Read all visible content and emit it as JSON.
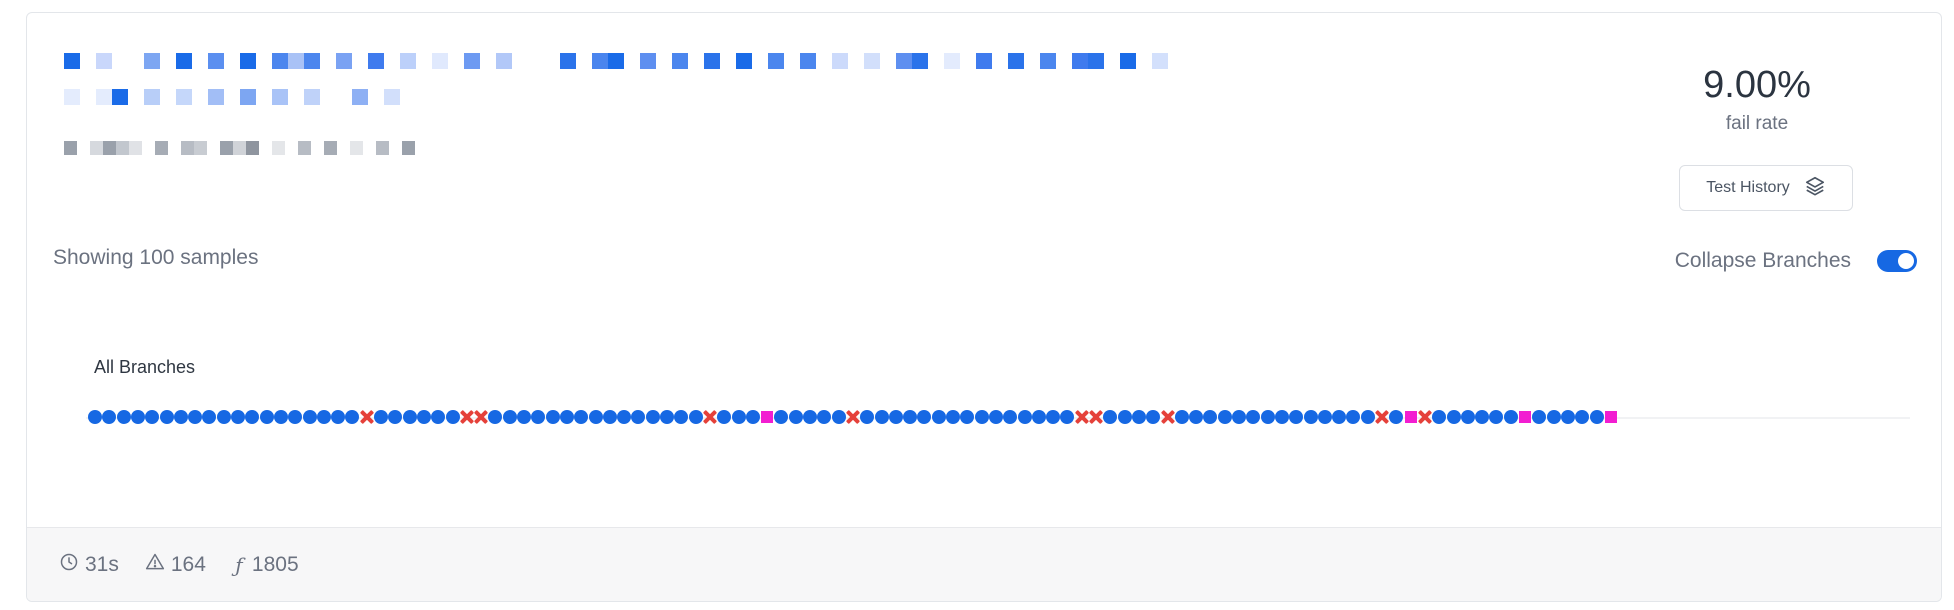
{
  "redacted_title": {
    "row1": [
      "#1a6be8",
      "#fff",
      "#c9d7fb",
      "#fff",
      "#fff",
      "#7da6f2",
      "#fff",
      "#1a6be8",
      "#fff",
      "#5b8ff0",
      "#fff",
      "#1a6be8",
      "#fff",
      "#4c86ee",
      "#a9c2f6",
      "#4c86ee",
      "#fff",
      "#7aa2f3",
      "#fff",
      "#3f7bee",
      "#fff",
      "#bcd0fa",
      "#fff",
      "#e0e9fd",
      "#fff",
      "#6d9af2",
      "#fff",
      "#b2c8f8",
      "#fff",
      "#fff",
      "#fff",
      "#2b73ea",
      "#fff",
      "#4a85ee",
      "#1a6be8",
      "#fff",
      "#5e8ff0",
      "#fff",
      "#4b86ee",
      "#fff",
      "#2b73ea",
      "#fff",
      "#1a6be8",
      "#fff",
      "#4b86ee",
      "#fff",
      "#4b86ee",
      "#fff",
      "#ccdafb",
      "#fff",
      "#d2dffb",
      "#fff",
      "#5e8ff0",
      "#2b73ea",
      "#fff",
      "#e3ebfd",
      "#fff",
      "#3f7bee",
      "#fff",
      "#2b73ea",
      "#fff",
      "#4b86ee",
      "#fff",
      "#3f7bee",
      "#2b73ea",
      "#fff",
      "#1a6be8",
      "#fff",
      "#d3e0fc",
      "#fff"
    ],
    "row2": [
      "#e4ecfd",
      "#fff",
      "#e4ecfd",
      "#1a6be8",
      "#fff",
      "#b8cef8",
      "#fff",
      "#c5d7fa",
      "#fff",
      "#a2bef6",
      "#fff",
      "#7da6f2",
      "#fff",
      "#a9c3f7",
      "#fff",
      "#bfd2f9",
      "#fff",
      "#fff",
      "#8eb0f4",
      "#fff",
      "#d2dffb",
      "#fff"
    ],
    "subtitle": [
      "#9aa1ab",
      "#fff",
      "#d6d9de",
      "#9aa1ab",
      "#c2c7ce",
      "#e0e2e6",
      "#fff",
      "#a6acb5",
      "#fff",
      "#b7bcc4",
      "#c8ccd2",
      "#fff",
      "#9aa1ab",
      "#d0d3d8",
      "#8f959f",
      "#fff",
      "#e4e6e9",
      "#fff",
      "#b7bcc4",
      "#fff",
      "#a6acb5",
      "#fff",
      "#e4e6e9",
      "#fff",
      "#b7bcc4",
      "#fff",
      "#9aa1ab",
      "#fff"
    ]
  },
  "stat": {
    "value": "9.00%",
    "label": "fail rate"
  },
  "history_button": {
    "label": "Test History",
    "icon": "layers-icon"
  },
  "samples_label": "Showing 100 samples",
  "collapse": {
    "label": "Collapse Branches",
    "enabled": true
  },
  "branch": {
    "label": "All Branches",
    "results": "PPPPPPPPPPPPPPPPPPPXPPPPPPXXPPPPPPPPPPPPPPPXPPPFPPPPPXPPPPPPPPPPPPPPPXXPPPPXPPPPPPPPPPPPPPXPFXPPPPPPFPPPPPF",
    "legend": {
      "P": "pass",
      "X": "fail",
      "F": "flaky"
    }
  },
  "footer": {
    "duration": "31s",
    "warnings": "164",
    "functions": "1805",
    "icons": [
      "clock-icon",
      "warning-icon",
      "function-icon"
    ]
  },
  "colors": {
    "accent": "#1668e3",
    "fail": "#e5413a",
    "flaky": "#f21ed1"
  }
}
